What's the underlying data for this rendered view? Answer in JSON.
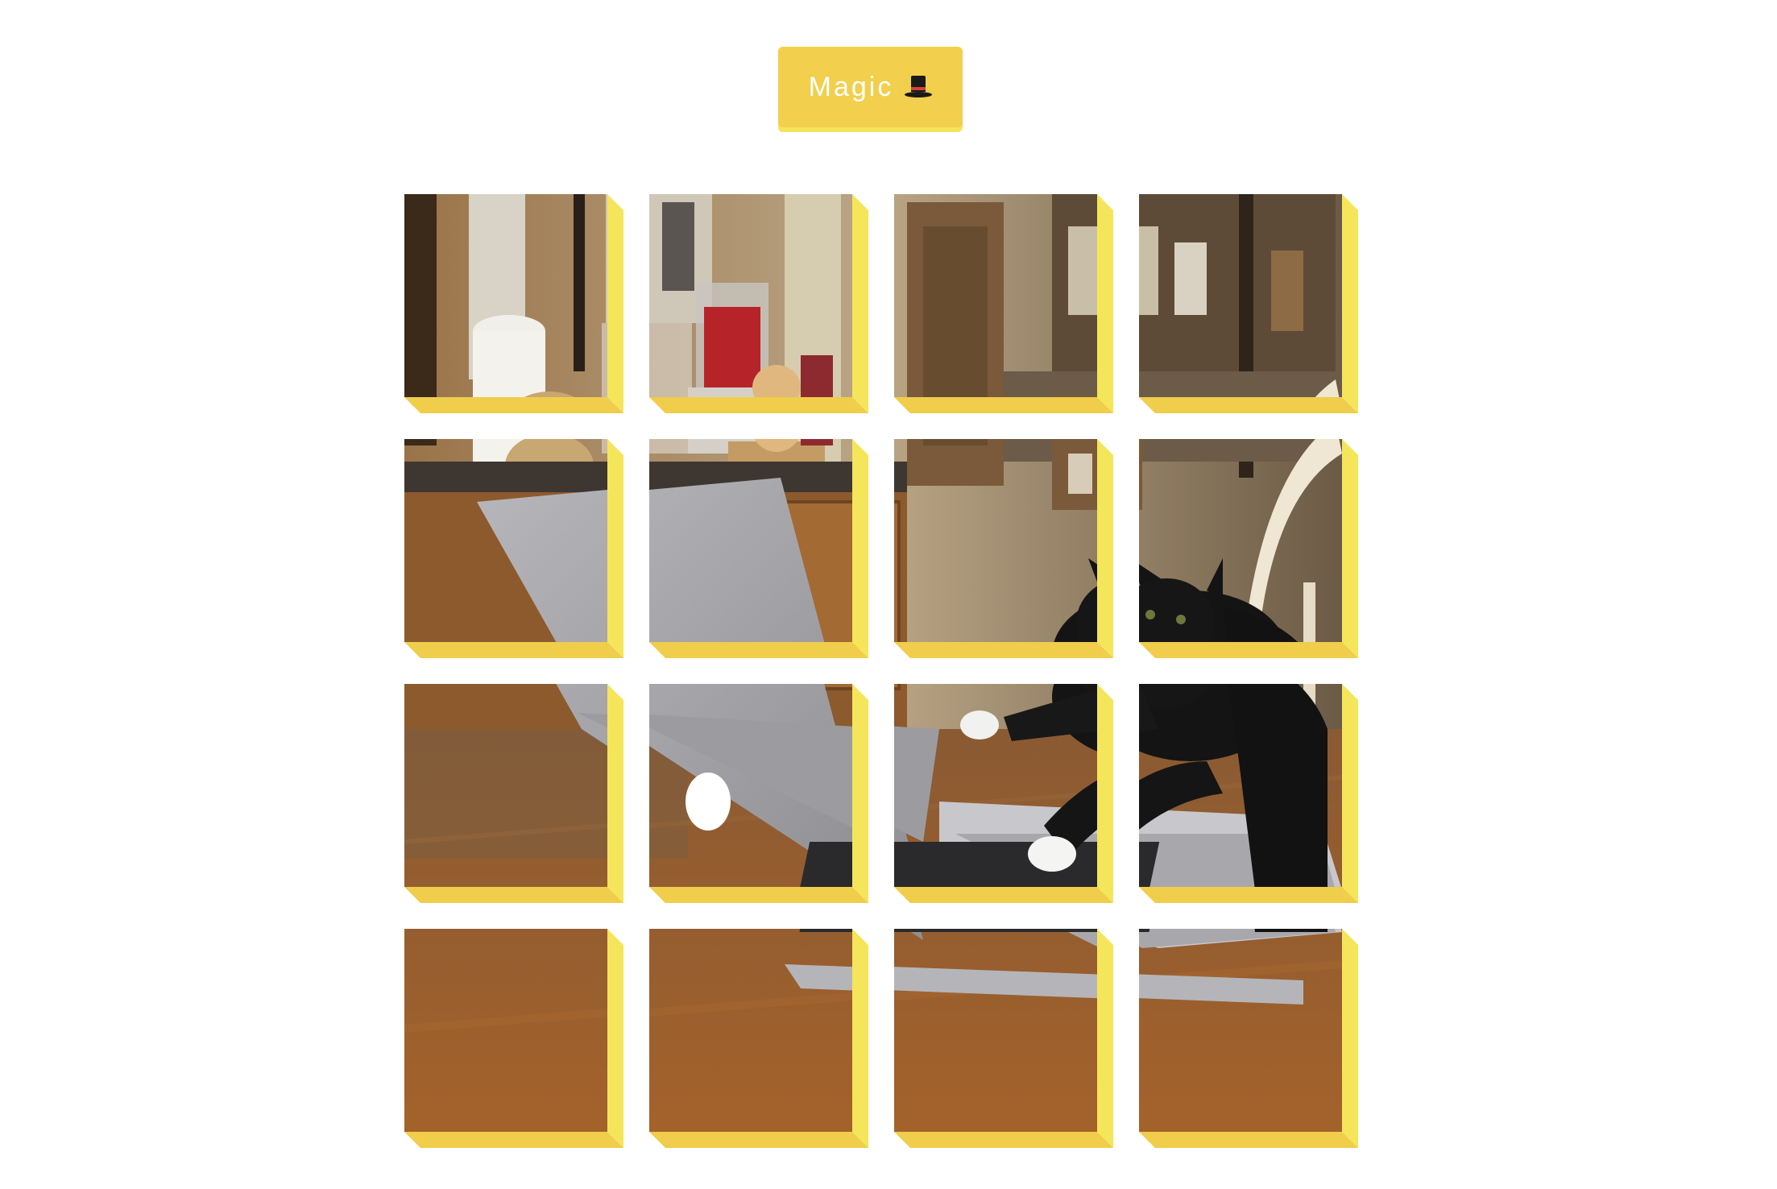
{
  "button": {
    "label": "Magic",
    "icon": "top-hat-icon"
  },
  "colors": {
    "accent": "#f2cf4c",
    "tile_side": "#f5e55a",
    "tile_bottom": "#f0cd4b",
    "button_text": "#ffffff"
  },
  "puzzle": {
    "rows": 4,
    "cols": 4,
    "tiles": [
      {
        "row": 0,
        "col": 0
      },
      {
        "row": 0,
        "col": 1
      },
      {
        "row": 0,
        "col": 2
      },
      {
        "row": 0,
        "col": 3
      },
      {
        "row": 1,
        "col": 0
      },
      {
        "row": 1,
        "col": 1
      },
      {
        "row": 1,
        "col": 2
      },
      {
        "row": 1,
        "col": 3
      },
      {
        "row": 2,
        "col": 0
      },
      {
        "row": 2,
        "col": 1
      },
      {
        "row": 2,
        "col": 2
      },
      {
        "row": 2,
        "col": 3
      },
      {
        "row": 3,
        "col": 0
      },
      {
        "row": 3,
        "col": 1
      },
      {
        "row": 3,
        "col": 2
      },
      {
        "row": 3,
        "col": 3
      }
    ]
  }
}
